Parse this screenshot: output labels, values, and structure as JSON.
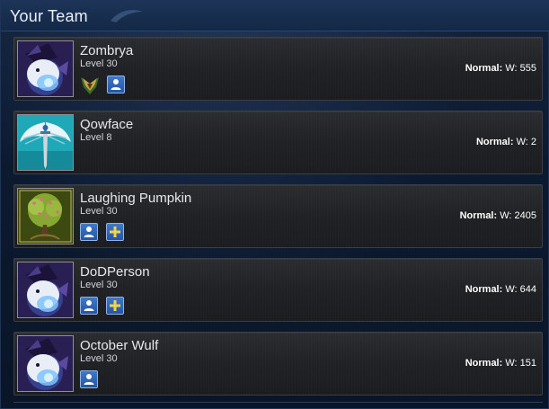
{
  "header": {
    "title": "Your Team"
  },
  "stat_label": "Normal:",
  "team": [
    {
      "name": "Zombrya",
      "level": "Level 30",
      "stat": "W: 555",
      "avatar": "poro-wizard-icon",
      "badges": [
        "rank-emblem",
        "person"
      ]
    },
    {
      "name": "Qowface",
      "level": "Level 8",
      "stat": "W: 2",
      "avatar": "winged-sword-icon",
      "badges": []
    },
    {
      "name": "Laughing Pumpkin",
      "level": "Level 30",
      "stat": "W: 2405",
      "avatar": "blossom-tree-icon",
      "badges": [
        "person",
        "plus"
      ]
    },
    {
      "name": "DoDPerson",
      "level": "Level 30",
      "stat": "W: 644",
      "avatar": "poro-wizard-icon",
      "badges": [
        "person",
        "plus"
      ]
    },
    {
      "name": "October Wulf",
      "level": "Level 30",
      "stat": "W: 151",
      "avatar": "poro-wizard-icon",
      "badges": [
        "person"
      ]
    }
  ],
  "colors": {
    "header_bg": "#1d3458",
    "row_bg": "#1f2124",
    "badge_blue": "#2f66b8",
    "text_primary": "#e6e8ec"
  }
}
